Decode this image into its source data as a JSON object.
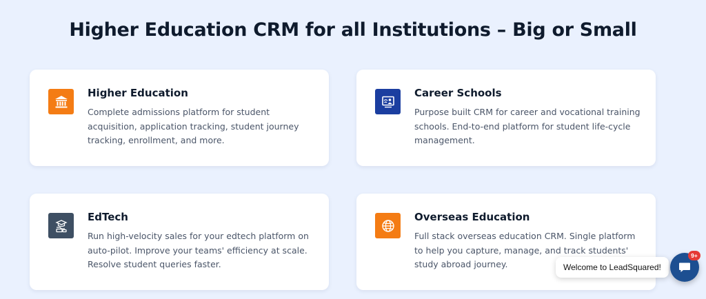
{
  "heading": "Higher Education CRM for all Institutions – Big or Small",
  "cards": [
    {
      "title": "Higher Education",
      "description": "Complete admissions platform for student acquisition, application tracking, student journey tracking, enrollment, and more.",
      "icon": "institution-icon",
      "icon_color": "#f47c14"
    },
    {
      "title": "Career Schools",
      "description": "Purpose built CRM for career and vocational training schools. End-to-end platform for student life-cycle management.",
      "icon": "presentation-board-icon",
      "icon_color": "#1b3ea0"
    },
    {
      "title": "EdTech",
      "description": "Run high-velocity sales for your edtech platform on auto-pilot. Improve your teams' efficiency at scale. Resolve student queries faster.",
      "icon": "edtech-icon",
      "icon_color": "#3e4f63"
    },
    {
      "title": "Overseas Education",
      "description": "Full stack overseas education CRM. Single platform to help you capture, manage, and track students' study abroad journey.",
      "icon": "globe-icon",
      "icon_color": "#f47c14"
    }
  ],
  "chat": {
    "welcome_text": "Welcome to LeadSquared!",
    "badge_count": "9+",
    "button_color": "#1d4f91"
  }
}
